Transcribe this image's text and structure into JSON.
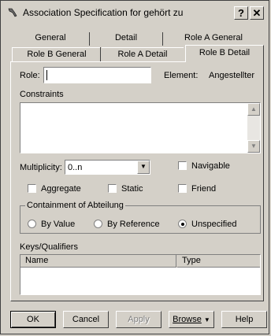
{
  "window": {
    "title": "Association Specification for gehört zu"
  },
  "titlebar_buttons": {
    "help": "?",
    "close": "✕"
  },
  "tabs_row1": [
    "General",
    "Detail",
    "Role A General"
  ],
  "tabs_row2": [
    "Role B General",
    "Role A Detail",
    "Role B Detail"
  ],
  "active_tab": "Role B Detail",
  "form": {
    "role_label": "Role:",
    "role_value": "",
    "element_label": "Element:",
    "element_value": "Angestellter",
    "constraints_label": "Constraints",
    "multiplicity_label": "Multiplicity:",
    "multiplicity_value": "0..n",
    "navigable_label": "Navigable",
    "aggregate_label": "Aggregate",
    "static_label": "Static",
    "friend_label": "Friend",
    "containment_label": "Containment of Abteilung",
    "by_value_label": "By Value",
    "by_reference_label": "By Reference",
    "unspecified_label": "Unspecified",
    "selected_containment": "Unspecified",
    "keys_label": "Keys/Qualifiers",
    "keys_columns": [
      "Name",
      "Type"
    ]
  },
  "buttons": {
    "ok": "OK",
    "cancel": "Cancel",
    "apply": "Apply",
    "browse": "Browse",
    "help": "Help"
  },
  "icons": {
    "title": "tool-icon",
    "dropdown": "chevron-down-icon"
  }
}
